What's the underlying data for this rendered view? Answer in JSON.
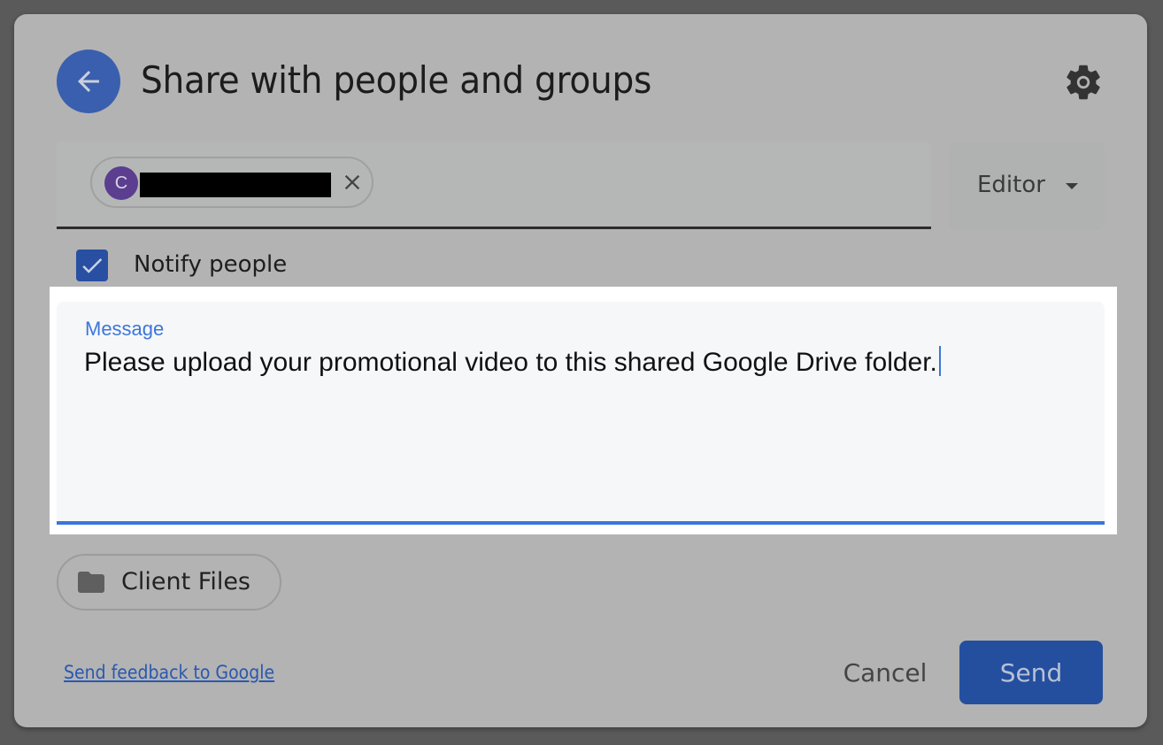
{
  "dialog": {
    "title": "Share with people and groups",
    "back_icon": "arrow-left-icon",
    "settings_icon": "gear-icon"
  },
  "recipients": {
    "chips": [
      {
        "avatar_initial": "C",
        "name": "[redacted]",
        "avatar_color": "#5b3e8f"
      }
    ],
    "remove_icon": "close-icon"
  },
  "role": {
    "selected": "Editor",
    "dropdown_icon": "caret-down-icon"
  },
  "notify": {
    "label": "Notify people",
    "checked": true
  },
  "message": {
    "label": "Message",
    "value": "Please upload your promotional video to this shared Google Drive folder."
  },
  "item": {
    "icon": "folder-icon",
    "label": "Client Files"
  },
  "footer": {
    "feedback_link": "Send feedback to Google",
    "cancel_label": "Cancel",
    "send_label": "Send"
  },
  "colors": {
    "accent": "#3b76d9",
    "primary_button": "#244f9e",
    "back_button": "#3a5fae"
  }
}
